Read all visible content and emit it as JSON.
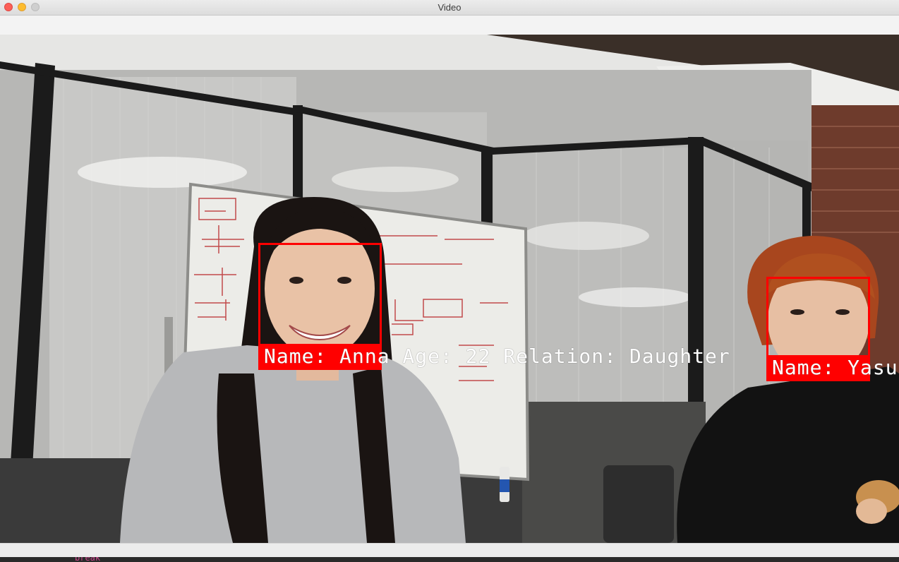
{
  "window": {
    "title": "Video"
  },
  "detections": [
    {
      "label": "Name: Anna Age: 22 Relation: Daughter"
    },
    {
      "label": "Name: Yasu"
    }
  ],
  "colors": {
    "box": "#ff0000",
    "label_text": "#ffffff"
  },
  "bottom_strip": {
    "text": "break"
  }
}
